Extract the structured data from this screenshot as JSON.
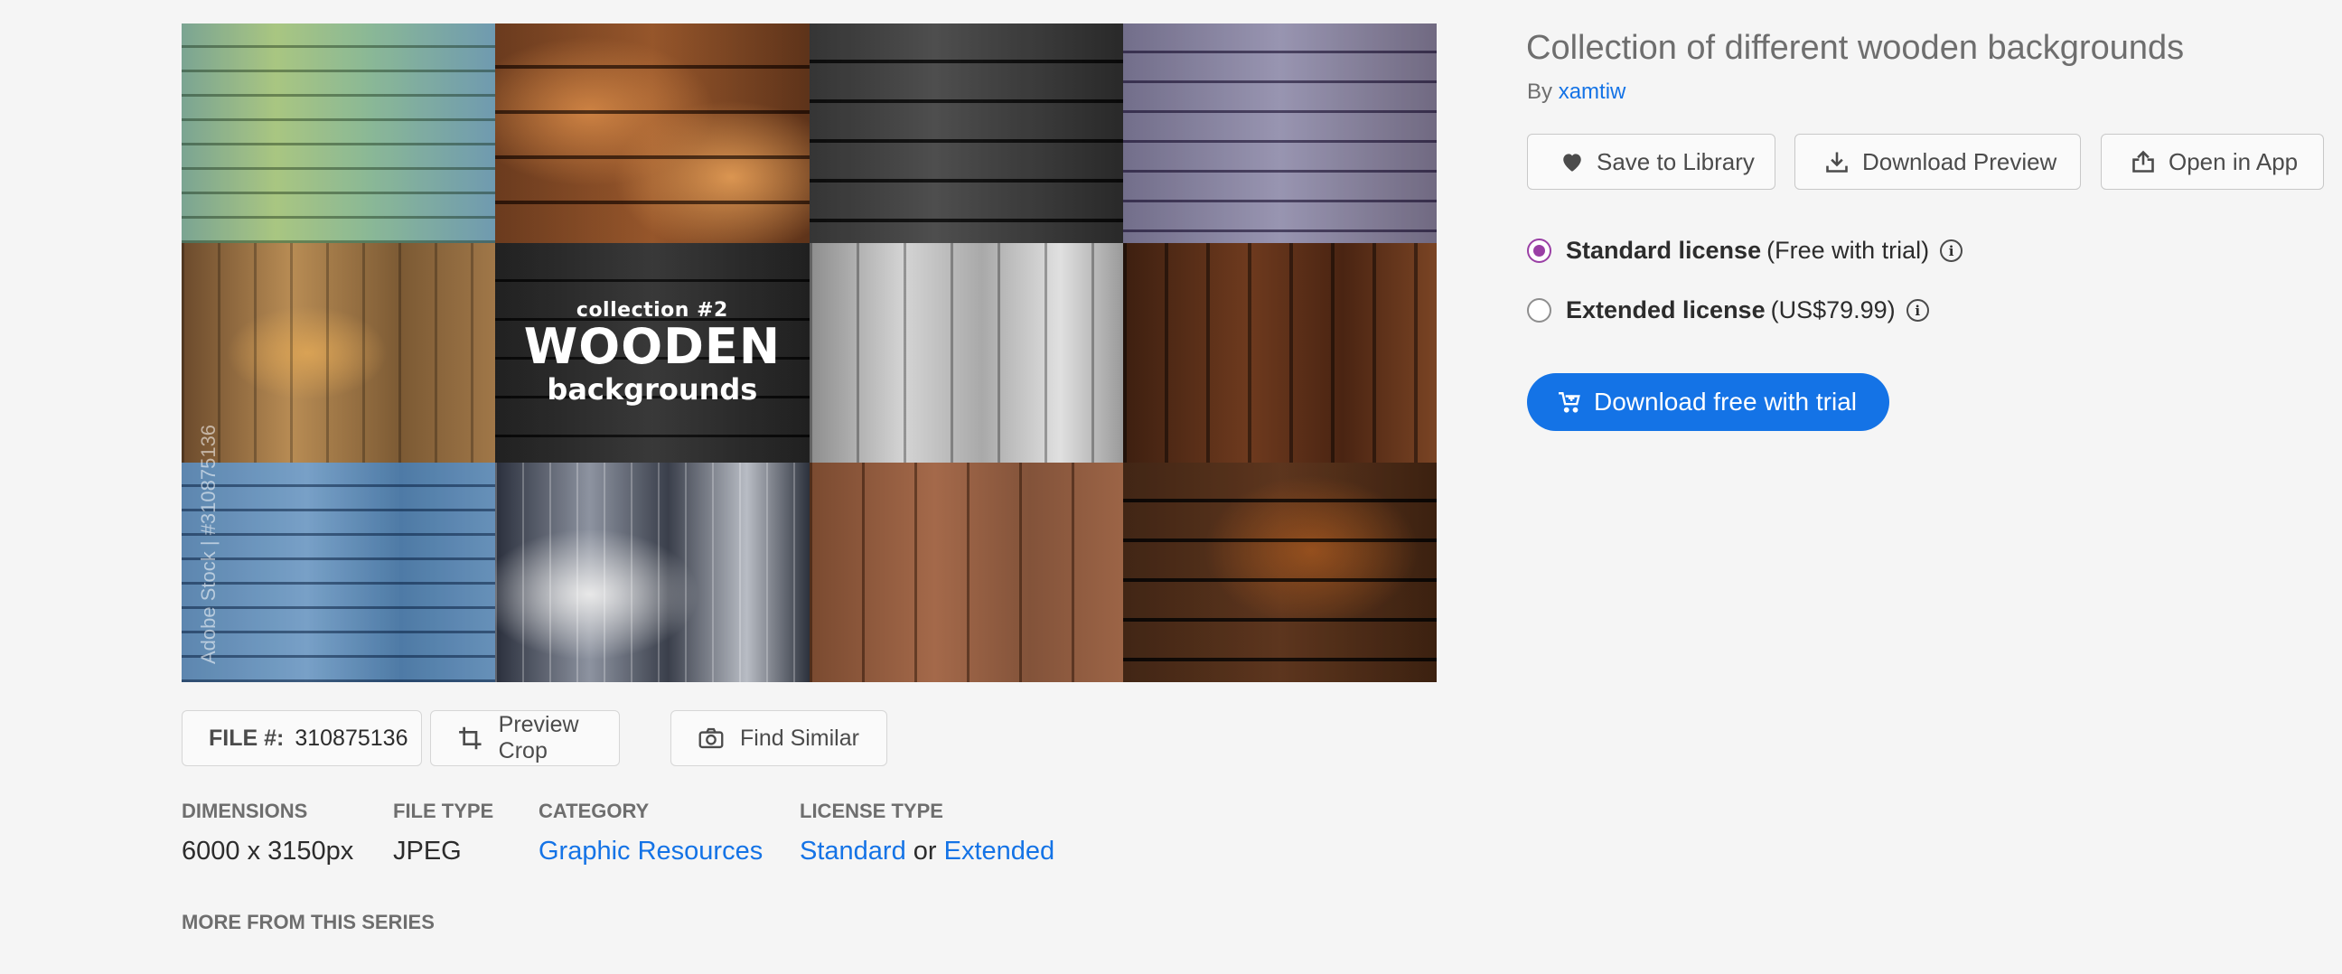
{
  "preview": {
    "overlay_sub": "collection #2",
    "overlay_main": "WOODEN",
    "overlay_bottom": "backgrounds",
    "watermark": "Adobe Stock | #310875136"
  },
  "file_info": {
    "file_label": "FILE #:",
    "file_number": "310875136",
    "preview_crop_label": "Preview Crop",
    "find_similar_label": "Find Similar"
  },
  "meta": {
    "dimensions_label": "DIMENSIONS",
    "dimensions_value": "6000 x 3150px",
    "filetype_label": "FILE TYPE",
    "filetype_value": "JPEG",
    "category_label": "CATEGORY",
    "category_value": "Graphic Resources",
    "license_label": "LICENSE TYPE",
    "license_standard": "Standard",
    "license_or": "or",
    "license_extended": "Extended",
    "more_series": "MORE FROM THIS SERIES"
  },
  "asset": {
    "title": "Collection of different wooden backgrounds",
    "by": "By",
    "author": "xamtiw"
  },
  "actions": {
    "save_label": "Save to Library",
    "download_preview_label": "Download Preview",
    "open_in_app_label": "Open in App"
  },
  "licenses": [
    {
      "name": "Standard license",
      "detail": "(Free with trial)",
      "selected": true
    },
    {
      "name": "Extended license",
      "detail": "(US$79.99)",
      "selected": false
    }
  ],
  "cta": {
    "label": "Download free with trial"
  },
  "colors": {
    "accent": "#1473e6",
    "radio_selected": "#9a3fa5"
  }
}
